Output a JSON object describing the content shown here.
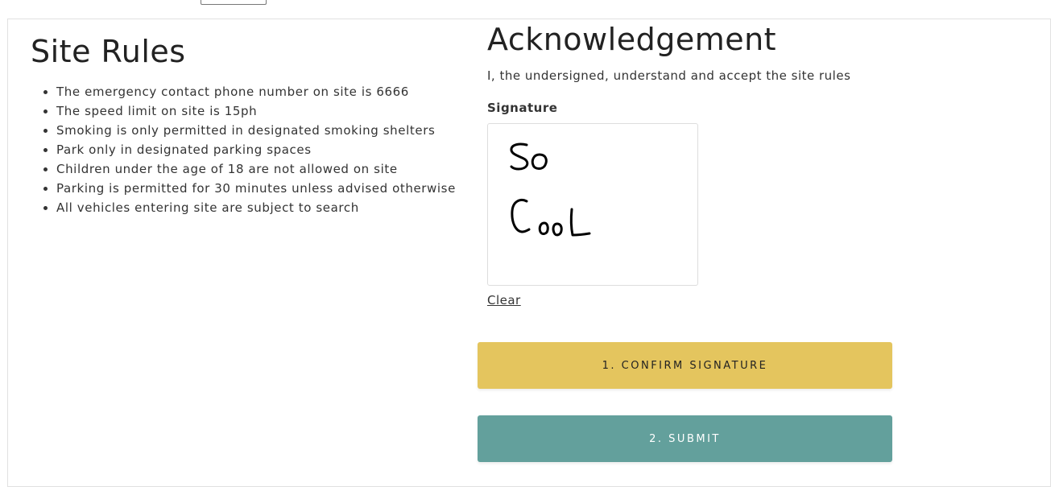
{
  "rules": {
    "title": "Site Rules",
    "items": [
      "The emergency contact phone number on site is 6666",
      "The speed limit on site is 15ph",
      "Smoking is only permitted in designated smoking shelters",
      "Park only in designated parking spaces",
      "Children under the age of 18 are not allowed on site",
      "Parking is permitted for 30 minutes unless advised otherwise",
      "All vehicles entering site are subject to search"
    ]
  },
  "acknowledgement": {
    "title": "Acknowledgement",
    "statement": "I, the undersigned, understand and accept the site rules",
    "signature_label": "Signature",
    "signature_handwriting": "So CooL",
    "clear_label": "Clear"
  },
  "actions": {
    "confirm_label": "1. CONFIRM SIGNATURE",
    "submit_label": "2. SUBMIT"
  },
  "colors": {
    "confirm_button": "#e4c55e",
    "submit_button": "#63a09c"
  }
}
